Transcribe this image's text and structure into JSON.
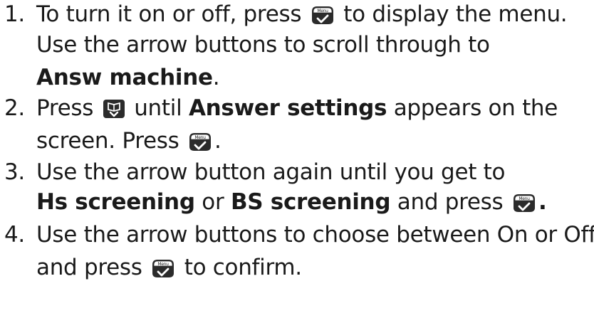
{
  "steps": [
    {
      "number": "1.",
      "lines": [
        [
          "To turn it on or off, press ",
          "{menu}",
          " to display the menu."
        ],
        [
          "Use the arrow buttons to scroll through to"
        ],
        [
          "**Answ machine**",
          "."
        ]
      ]
    },
    {
      "number": "2.",
      "lines": [
        [
          "Press ",
          "{book}",
          " until ",
          "**Answer settings**",
          " appears on the"
        ],
        [
          "screen. Press ",
          "{menu}",
          "."
        ]
      ]
    },
    {
      "number": "3.",
      "lines": [
        [
          "Use the arrow button again until you get to"
        ],
        [
          "**Hs screening**",
          " or ",
          "**BS screening**",
          " and press ",
          "{menu}",
          "**.**"
        ]
      ]
    },
    {
      "number": "4.",
      "lines": [
        [
          "Use the arrow buttons to choose between On or Off"
        ],
        [
          "and press ",
          "{menu}",
          " to confirm."
        ]
      ]
    }
  ],
  "icons": {
    "menu": {
      "name": "menu-button-icon",
      "label": "Menu"
    },
    "book": {
      "name": "phonebook-down-button-icon"
    }
  }
}
